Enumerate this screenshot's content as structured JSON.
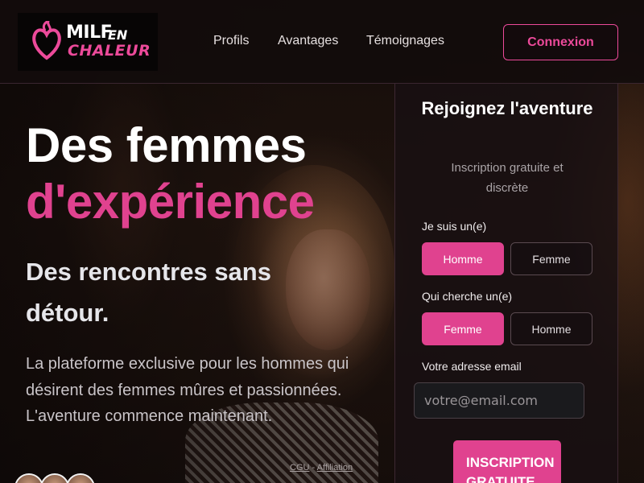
{
  "header": {
    "logo": {
      "line1": "MILF",
      "line2": "EN",
      "line3": "CHALEUR"
    },
    "nav": [
      {
        "label": "Profils"
      },
      {
        "label": "Avantages"
      },
      {
        "label": "Témoignages"
      }
    ],
    "login_label": "Connexion"
  },
  "hero": {
    "title_line1": "Des femmes",
    "title_line2": "d'expérience",
    "subtitle": "Des rencontres sans détour.",
    "description": "La plateforme exclusive pour les hommes qui désirent des femmes mûres et passionnées. L'aventure commence maintenant."
  },
  "footer": {
    "cgu": "CGU",
    "separator": "-",
    "affiliation": "Affiliation"
  },
  "form": {
    "title": "Rejoignez l'aventure",
    "subtitle": "Inscription gratuite et discrète",
    "iam_label": "Je suis un(e)",
    "iam_options": [
      "Homme",
      "Femme"
    ],
    "iam_selected": "Homme",
    "seek_label": "Qui cherche un(e)",
    "seek_options": [
      "Femme",
      "Homme"
    ],
    "seek_selected": "Femme",
    "email_label": "Votre adresse email",
    "email_placeholder": "votre@email.com",
    "submit_label": "INSCRIPTION GRATUITE"
  },
  "colors": {
    "accent": "#e0428f",
    "background": "#120c0b",
    "panel": "#181012"
  }
}
